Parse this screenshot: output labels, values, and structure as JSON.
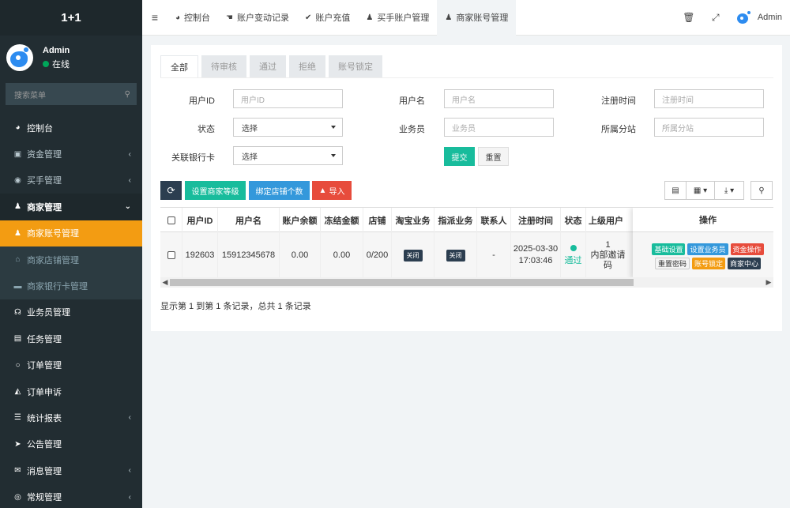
{
  "sidebar": {
    "brand": "1+1",
    "user": {
      "name": "Admin",
      "status": "在线"
    },
    "search_placeholder": "搜索菜单",
    "items": [
      {
        "label": "控制台",
        "icon": "dashboard-icon",
        "glyph": "◕",
        "arrow": ""
      },
      {
        "label": "资金管理",
        "icon": "money-icon",
        "glyph": "▣",
        "arrow": "‹"
      },
      {
        "label": "买手管理",
        "icon": "user-circle-icon",
        "glyph": "◉",
        "arrow": "‹"
      },
      {
        "label": "商家管理",
        "icon": "user-icon",
        "glyph": "♟",
        "arrow": "⌄"
      },
      {
        "label": "商家账号管理",
        "icon": "user-icon",
        "glyph": "♟",
        "arrow": ""
      },
      {
        "label": "商家店铺管理",
        "icon": "bank-icon",
        "glyph": "⌂",
        "arrow": ""
      },
      {
        "label": "商家银行卡管理",
        "icon": "credit-card-icon",
        "glyph": "▬",
        "arrow": ""
      },
      {
        "label": "业务员管理",
        "icon": "headset-icon",
        "glyph": "☊",
        "arrow": ""
      },
      {
        "label": "任务管理",
        "icon": "list-icon",
        "glyph": "▤",
        "arrow": ""
      },
      {
        "label": "订单管理",
        "icon": "circle-icon",
        "glyph": "○",
        "arrow": ""
      },
      {
        "label": "订单申诉",
        "icon": "compass-icon",
        "glyph": "◭",
        "arrow": ""
      },
      {
        "label": "统计报表",
        "icon": "database-icon",
        "glyph": "☰",
        "arrow": "‹"
      },
      {
        "label": "公告管理",
        "icon": "send-icon",
        "glyph": "➤",
        "arrow": ""
      },
      {
        "label": "消息管理",
        "icon": "bullhorn-icon",
        "glyph": "✉",
        "arrow": "‹"
      },
      {
        "label": "常规管理",
        "icon": "cog-icon",
        "glyph": "◎",
        "arrow": "‹"
      }
    ]
  },
  "topnav": {
    "tabs": [
      {
        "label": "控制台",
        "icon": "dashboard-icon",
        "glyph": "◕"
      },
      {
        "label": "账户变动记录",
        "icon": "hand-icon",
        "glyph": "☚"
      },
      {
        "label": "账户充值",
        "icon": "check-circle-icon",
        "glyph": "✔"
      },
      {
        "label": "买手账户管理",
        "icon": "user-icon",
        "glyph": "♟"
      },
      {
        "label": "商家账号管理",
        "icon": "user-icon",
        "glyph": "♟"
      }
    ],
    "admin": "Admin"
  },
  "filter_tabs": [
    "全部",
    "待审核",
    "通过",
    "拒绝",
    "账号锁定"
  ],
  "form": {
    "user_id_label": "用户ID",
    "user_id_ph": "用户ID",
    "username_label": "用户名",
    "username_ph": "用户名",
    "reg_time_label": "注册时间",
    "reg_time_ph": "注册时间",
    "status_label": "状态",
    "status_value": "选择",
    "salesman_label": "业务员",
    "salesman_ph": "业务员",
    "branch_label": "所属分站",
    "branch_ph": "所属分站",
    "bank_label": "关联银行卡",
    "bank_value": "选择",
    "submit": "提交",
    "reset": "重置"
  },
  "toolbar": {
    "set_level": "设置商家等级",
    "bind_shops": "绑定店铺个数",
    "import": "导入"
  },
  "table": {
    "headers": [
      "用户ID",
      "用户名",
      "账户余额",
      "冻结金额",
      "店铺",
      "淘宝业务",
      "指派业务",
      "联系人",
      "注册时间",
      "状态",
      "上级用户"
    ],
    "row": {
      "user_id": "192603",
      "username": "15912345678",
      "balance": "0.00",
      "frozen": "0.00",
      "shops": "0/200",
      "taobao": "关闭",
      "assign": "关闭",
      "contact": "-",
      "reg_date": "2025-03-30",
      "reg_clock": "17:03:46",
      "status": "通过",
      "parent_line1": "1",
      "parent_line2": "内部邀请",
      "parent_line3": "码"
    },
    "ops_header": "操作",
    "ops": {
      "basic": "基础设置",
      "set_salesman": "设置业务员",
      "funds": "资金操作",
      "reset_pwd": "重置密码",
      "lock": "账号锁定",
      "center": "商家中心"
    }
  },
  "pager_text": "显示第 1 到第 1 条记录，总共 1 条记录",
  "colors": {
    "accent": "#f39c12",
    "success": "#18bc9c",
    "primary": "#3498db",
    "danger": "#e74c3c",
    "sidebar": "#222d32"
  }
}
